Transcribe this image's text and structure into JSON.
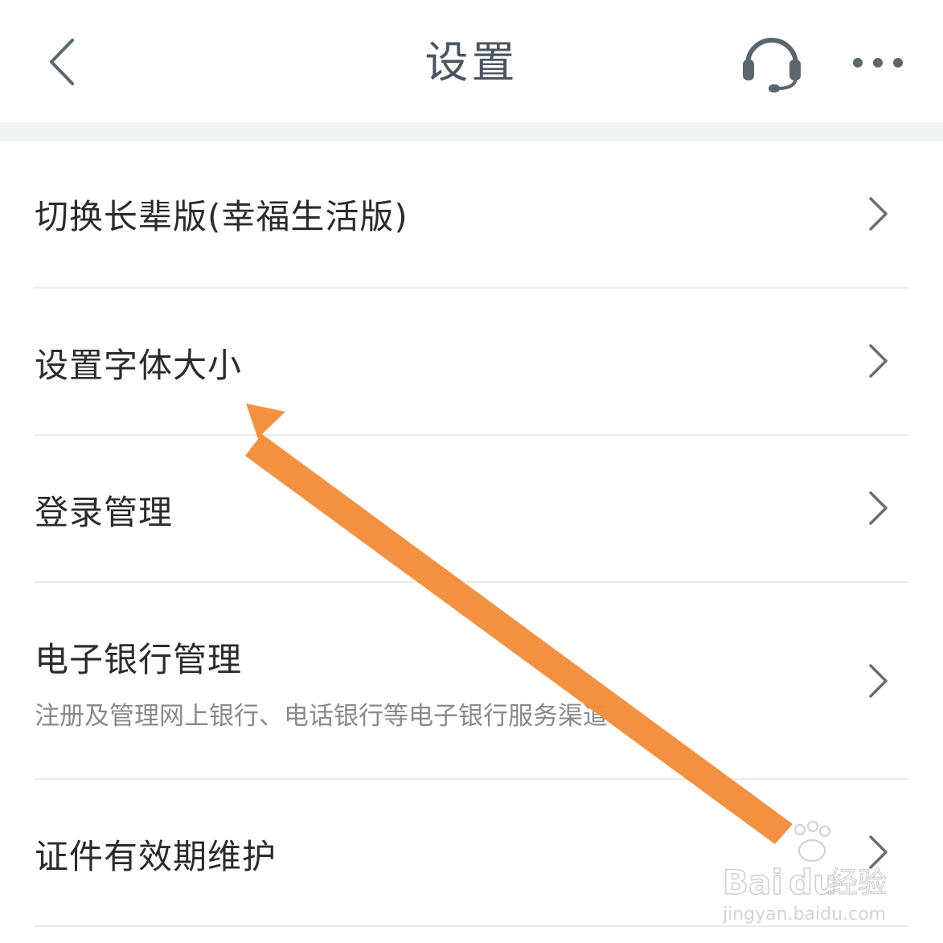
{
  "header": {
    "title": "设置",
    "back_icon": "chevron-left-icon",
    "service_icon": "headset-icon",
    "more_icon": "more-dots-icon"
  },
  "settings": {
    "items": [
      {
        "label": "切换长辈版(幸福生活版)"
      },
      {
        "label": "设置字体大小"
      },
      {
        "label": "登录管理"
      },
      {
        "label": "电子银行管理",
        "subtitle": "注册及管理网上银行、电话银行等电子银行服务渠道"
      },
      {
        "label": "证件有效期维护"
      }
    ]
  },
  "overlay": {
    "arrow_color": "#f28c38",
    "watermark_brand": "Bai",
    "watermark_brand2": "du",
    "watermark_cn": "经验",
    "watermark_url": "jingyan.baidu.com"
  },
  "colors": {
    "title": "#4b5560",
    "icon": "#5a6670",
    "chevron": "#6d6d6d",
    "divider": "#ececec",
    "gap": "#f2f3f5"
  }
}
